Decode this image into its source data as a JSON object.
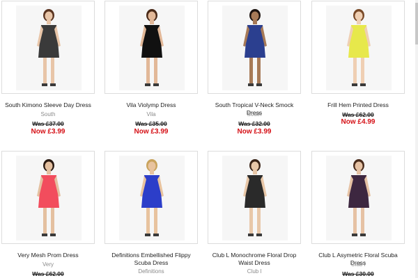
{
  "products": [
    {
      "name": "South Kimono Sleeve Day Dress",
      "brand": "South",
      "was": "Was £37.00",
      "now": "Now £3.99",
      "colors": {
        "dress": "#3a3a3a",
        "skin": "#e8c5a8",
        "hair": "#5a3420"
      },
      "icon": "product-photo"
    },
    {
      "name": "Vila Violymp Dress",
      "brand": "Vila",
      "was": "Was £35.00",
      "now": "Now £3.99",
      "colors": {
        "dress": "#111111",
        "skin": "#e2b898",
        "hair": "#4a2a18"
      },
      "icon": "product-photo"
    },
    {
      "name": "South Tropical V-Neck Smock Dress",
      "brand": "South",
      "was": "Was £32.00",
      "now": "Now £3.99",
      "colors": {
        "dress": "#2b3f8f",
        "skin": "#a77a57",
        "hair": "#1d1410"
      },
      "icon": "product-photo"
    },
    {
      "name": "Frill Hem Printed Dress",
      "brand": "",
      "was": "Was £62.00",
      "now": "Now £4.99",
      "colors": {
        "dress": "#e7e84b",
        "skin": "#efcfb3",
        "hair": "#7a4a28"
      },
      "icon": "product-photo"
    },
    {
      "name": "Very Mesh Prom Dress",
      "brand": "Very",
      "was": "Was £62.00",
      "now": "",
      "colors": {
        "dress": "#f24d5d",
        "skin": "#e4c0a0",
        "hair": "#2a1a12"
      },
      "icon": "product-photo"
    },
    {
      "name": "Definitions Embellished Flippy Scuba Dress",
      "brand": "Definitions",
      "was": "",
      "now": "",
      "colors": {
        "dress": "#2c3ec9",
        "skin": "#e8c39e",
        "hair": "#c9a35c"
      },
      "icon": "product-photo"
    },
    {
      "name": "Club L Monochrome Floral Drop Waist Dress",
      "brand": "Club l",
      "was": "",
      "now": "",
      "colors": {
        "dress": "#2a2a2a",
        "skin": "#e8c7a8",
        "hair": "#3a2418"
      },
      "icon": "product-photo"
    },
    {
      "name": "Club L Asymetric Floral Scuba Dress",
      "brand": "Club l",
      "was": "Was £30.00",
      "now": "",
      "colors": {
        "dress": "#3d2740",
        "skin": "#e6c2a4",
        "hair": "#4a2c1c"
      },
      "icon": "product-photo"
    }
  ],
  "colors": {
    "price_now": "#d51016",
    "border": "#dcdcdc",
    "brand_text": "#8a8a8a"
  }
}
